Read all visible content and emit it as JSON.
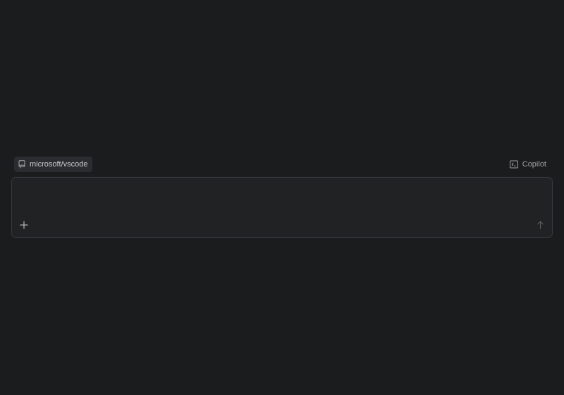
{
  "context": {
    "repository": {
      "label": "microsoft/vscode",
      "icon": "repo-icon"
    },
    "agent": {
      "label": "Copilot",
      "icon": "terminal-icon"
    }
  },
  "composer": {
    "value": "",
    "placeholder": "",
    "add_icon": "plus-icon",
    "send_icon": "arrow-up-icon"
  },
  "colors": {
    "background": "#1b1c1e",
    "composer_background": "#212224",
    "composer_border": "#37383b",
    "chip_background": "#2b2c2f",
    "text_primary": "#c9cacc",
    "text_secondary": "#a0a1a4"
  }
}
